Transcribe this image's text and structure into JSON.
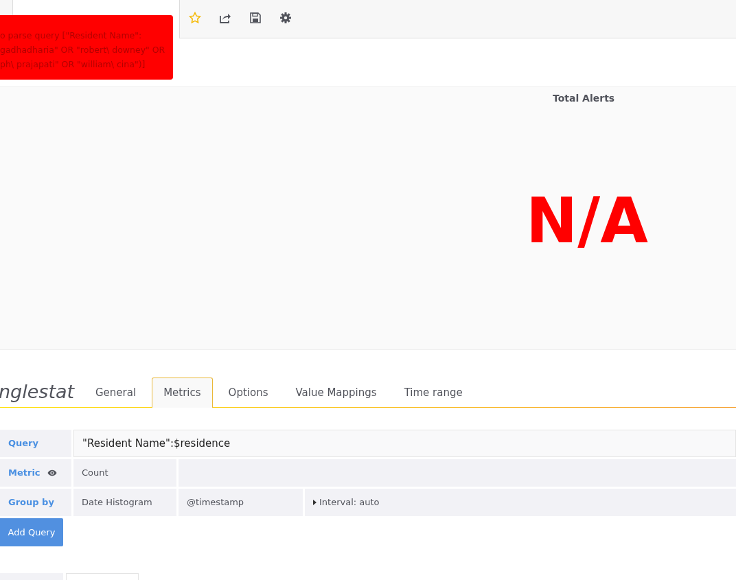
{
  "toast": {
    "lines": [
      "o parse query [\"Resident Name\":",
      "gadhadharia\" OR \"robert\\ downey\" OR",
      "ph\\ prajapati\" OR \"william\\ cina\")]"
    ]
  },
  "panel": {
    "title": "Total Alerts",
    "value": "N/A"
  },
  "editor": {
    "title": "nglestat",
    "tabs": [
      {
        "label": "General",
        "selected": false
      },
      {
        "label": "Metrics",
        "selected": true
      },
      {
        "label": "Options",
        "selected": false
      },
      {
        "label": "Value Mappings",
        "selected": false
      },
      {
        "label": "Time range",
        "selected": false
      }
    ],
    "query": {
      "label": "Query",
      "value": "\"Resident Name\":$residence"
    },
    "metric": {
      "label": "Metric",
      "type": "Count"
    },
    "group_by": {
      "label": "Group by",
      "type": "Date Histogram",
      "field": "@timestamp",
      "interval": "Interval: auto"
    },
    "add_button": "Add Query"
  }
}
